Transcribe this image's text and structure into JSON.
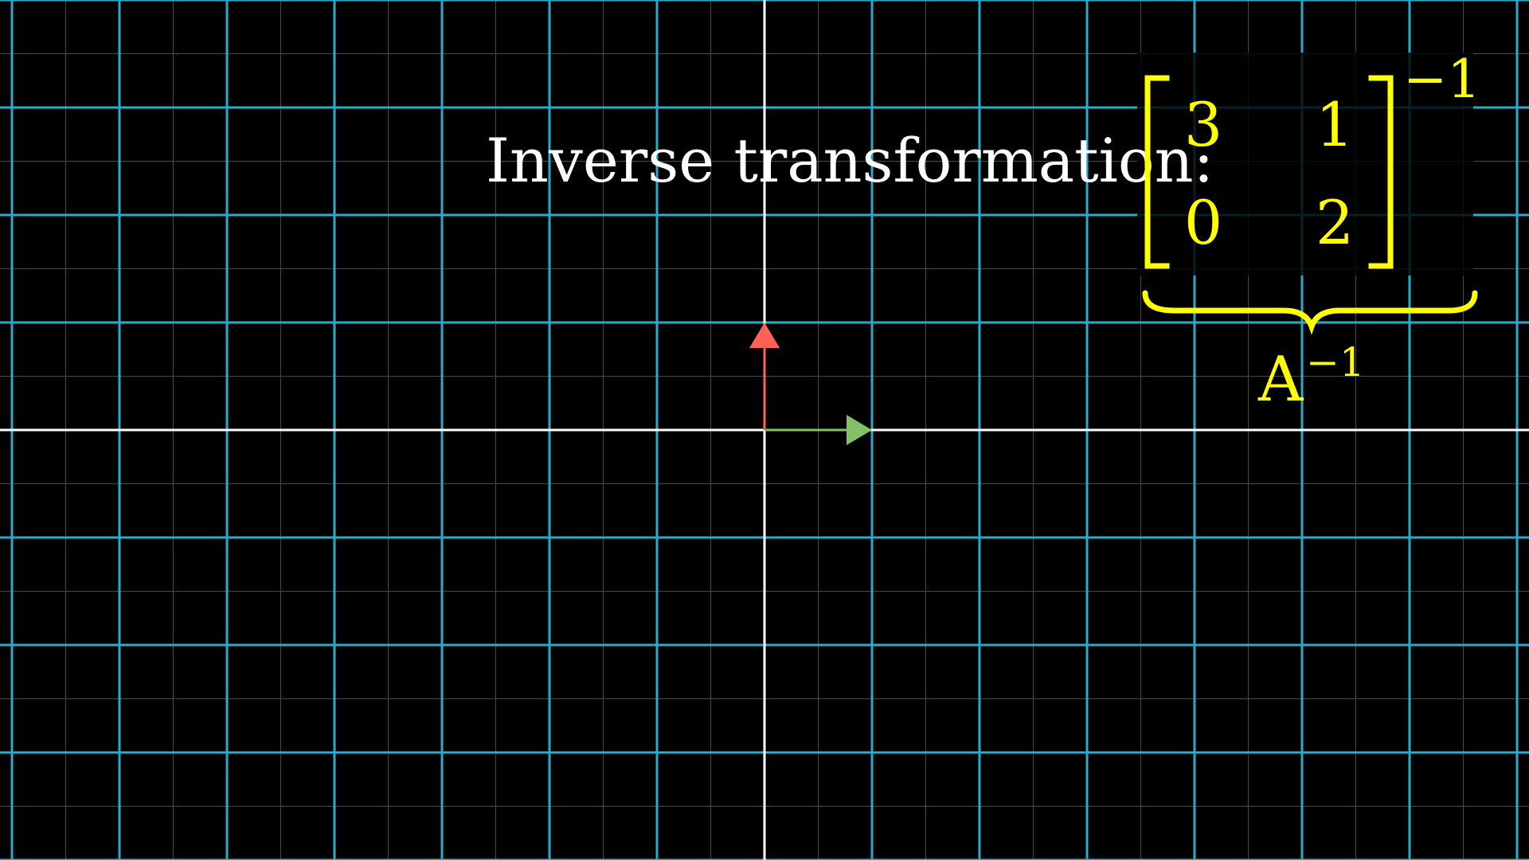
{
  "colors": {
    "background": "#000000",
    "grid_major": "#29abca",
    "grid_minor": "#4a4a4a",
    "axis": "#ffffff",
    "vector_i": "#83c167",
    "vector_j": "#fc6255",
    "matrix": "#ffff00",
    "text": "#ffffff"
  },
  "label": {
    "text": "Inverse transformation:"
  },
  "matrix": {
    "entries": [
      [
        "3",
        "1"
      ],
      [
        "0",
        "2"
      ]
    ],
    "exponent": "−1",
    "name": "A",
    "name_exponent": "−1"
  },
  "grid": {
    "x_range": [
      -7,
      7
    ],
    "y_range": [
      -4,
      4
    ],
    "minor_subdivisions": 2
  },
  "vectors": [
    {
      "name": "i-hat",
      "x": 1,
      "y": 0,
      "color_key": "vector_i"
    },
    {
      "name": "j-hat",
      "x": 0,
      "y": 1,
      "color_key": "vector_j"
    }
  ]
}
